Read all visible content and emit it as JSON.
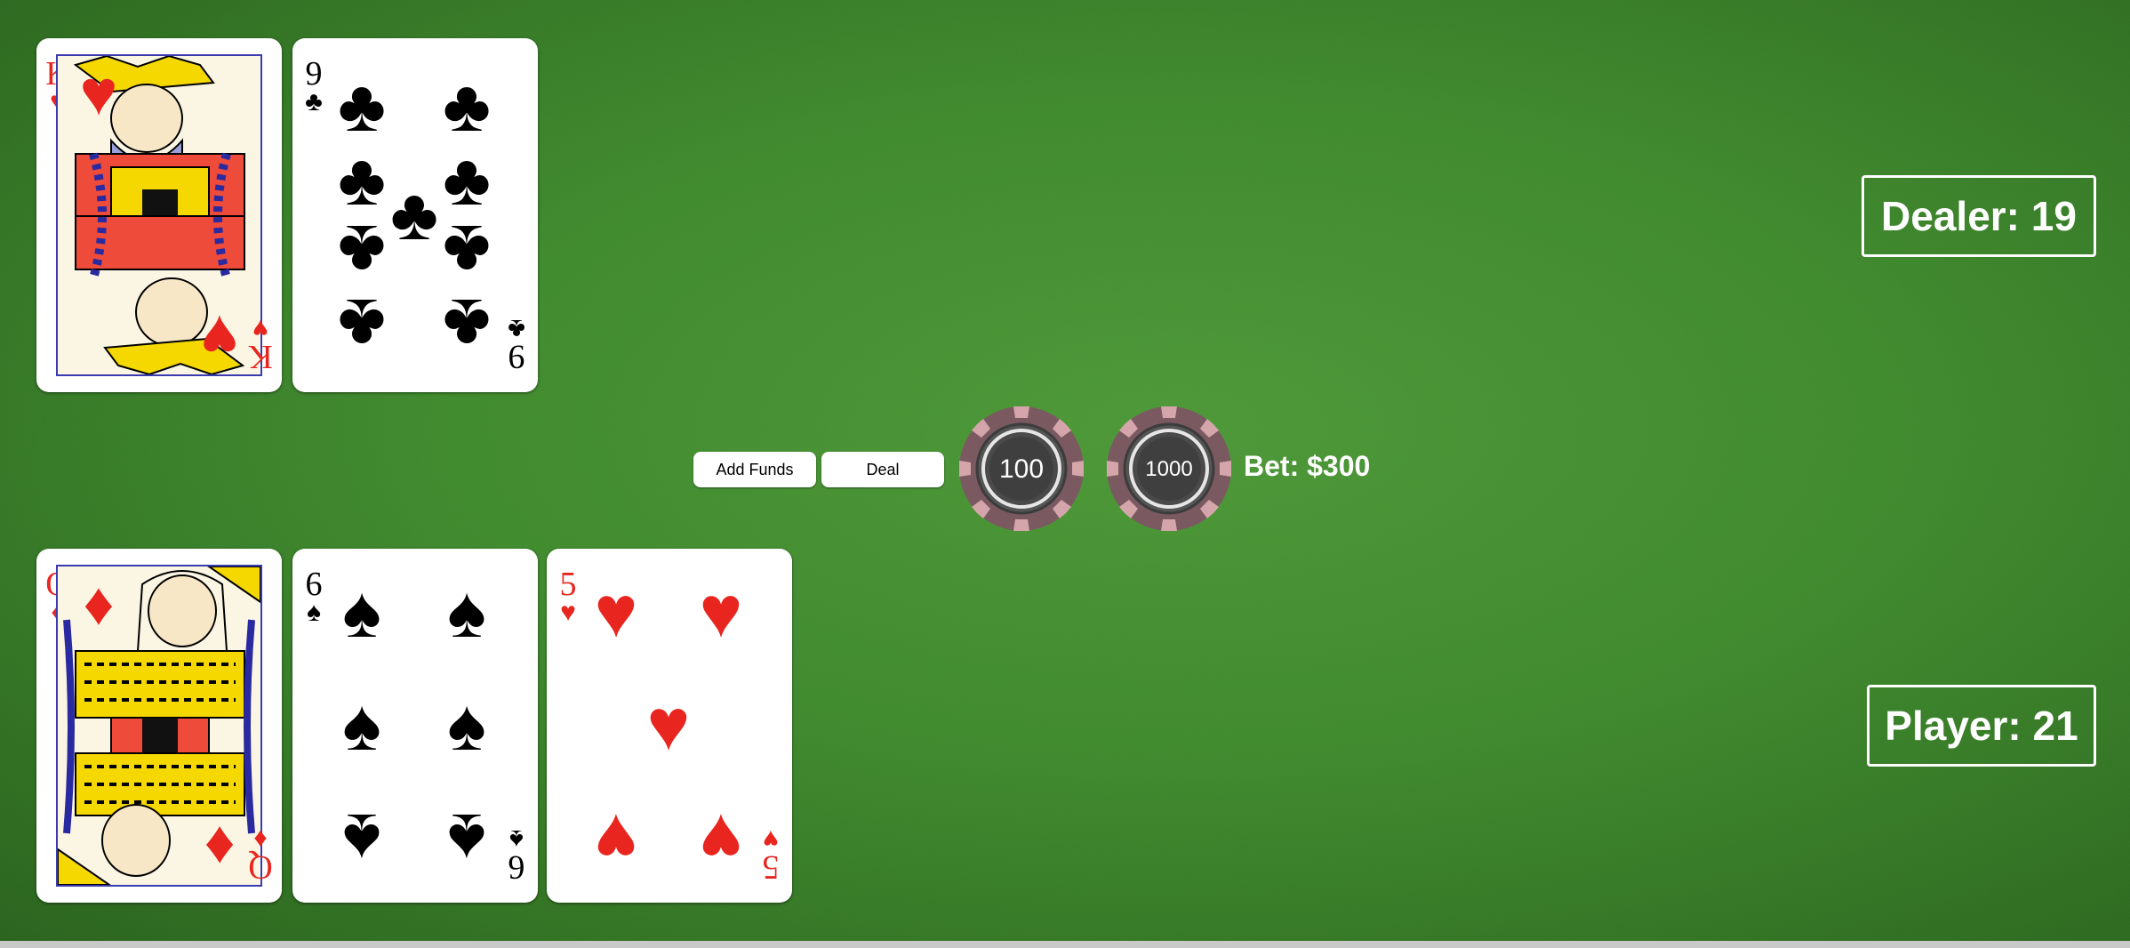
{
  "dealer": {
    "score_label": "Dealer: 19",
    "cards": [
      {
        "rank": "K",
        "suit": "♥",
        "color": "red",
        "kind": "face",
        "face_name": "king"
      },
      {
        "rank": "9",
        "suit": "♣",
        "color": "black",
        "kind": "pip"
      }
    ]
  },
  "player": {
    "score_label": "Player: 21",
    "cards": [
      {
        "rank": "Q",
        "suit": "♦",
        "color": "red",
        "kind": "face",
        "face_name": "queen"
      },
      {
        "rank": "6",
        "suit": "♠",
        "color": "black",
        "kind": "pip"
      },
      {
        "rank": "5",
        "suit": "♥",
        "color": "red",
        "kind": "pip"
      }
    ]
  },
  "controls": {
    "add_funds_label": "Add Funds",
    "deal_label": "Deal"
  },
  "chips": [
    {
      "value_label": "100"
    },
    {
      "value_label": "1000"
    }
  ],
  "bet_label": "Bet: $300",
  "colors": {
    "felt": "#3f8a2e",
    "red_suit": "#e8261f",
    "chip_body": "#7a5a60",
    "chip_stripe": "#d4a6ab"
  }
}
